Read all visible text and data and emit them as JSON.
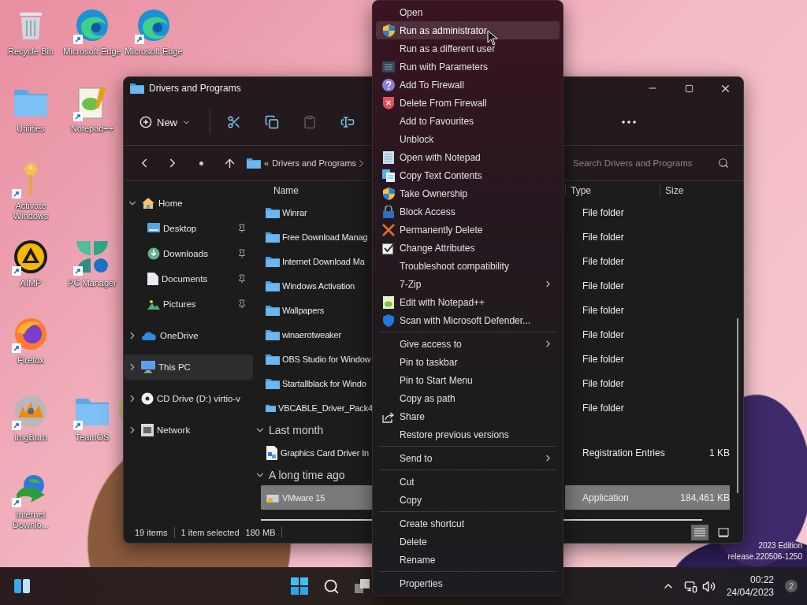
{
  "desktop": {
    "columns": [
      [
        {
          "label": "Recycle Bin",
          "shortcut": false
        },
        {
          "label": "Utilities",
          "shortcut": false
        },
        {
          "label": "Activate Windows",
          "shortcut": true
        },
        {
          "label": "AIMP",
          "shortcut": true
        },
        {
          "label": "Firefox",
          "shortcut": true
        },
        {
          "label": "ImgBurn",
          "shortcut": true
        },
        {
          "label": "Internet Downlo...",
          "shortcut": true
        }
      ],
      [
        {
          "label": "Microsoft Edge",
          "shortcut": true
        },
        {
          "label": "Notepad++",
          "shortcut": true
        },
        {
          "label": "PC Manager",
          "shortcut": true
        },
        {
          "label": "TeamOS",
          "shortcut": true
        }
      ],
      [
        {
          "label": "Microsoft Edge",
          "shortcut": true
        }
      ]
    ]
  },
  "explorer": {
    "title": "Drivers and Programs",
    "toolbar": {
      "new_label": "New",
      "actions": [
        {
          "kind": "cut",
          "disabled": false
        },
        {
          "kind": "copy",
          "disabled": false
        },
        {
          "kind": "paste",
          "disabled": true
        },
        {
          "kind": "rename",
          "disabled": false
        }
      ]
    },
    "address": {
      "crumbs": [
        "«",
        "Drivers and Programs"
      ]
    },
    "search": {
      "placeholder": "Search Drivers and Programs"
    },
    "nav": [
      {
        "label": "Home",
        "expanded": true,
        "selected": false,
        "children": [
          {
            "label": "Desktop",
            "pinned": true,
            "selected": false
          },
          {
            "label": "Downloads",
            "pinned": true,
            "selected": false
          },
          {
            "label": "Documents",
            "pinned": true,
            "selected": false
          },
          {
            "label": "Pictures",
            "pinned": true,
            "selected": false
          }
        ]
      },
      {
        "label": "OneDrive",
        "expanded": false,
        "selected": false
      },
      {
        "label": "This PC",
        "expanded": false,
        "selected": true
      },
      {
        "label": "CD Drive (D:) virtio-v",
        "expanded": false,
        "selected": false
      },
      {
        "label": "Network",
        "expanded": false,
        "selected": false
      }
    ],
    "columns": [
      "Name",
      "Type",
      "Size"
    ],
    "groups": [
      {
        "rows": [
          {
            "name": "Winrar",
            "type": "File folder",
            "kind": "folder",
            "selected": false
          },
          {
            "name": "Free Download Manag",
            "type": "File folder",
            "kind": "folder",
            "selected": false
          },
          {
            "name": "Internet Download Ma",
            "type": "File folder",
            "kind": "folder",
            "selected": false
          },
          {
            "name": "Windows Activation",
            "type": "File folder",
            "kind": "folder",
            "selected": false
          },
          {
            "name": "Wallpapers",
            "type": "File folder",
            "kind": "folder",
            "selected": false
          },
          {
            "name": "winaerotweaker",
            "type": "File folder",
            "kind": "folder",
            "selected": false
          },
          {
            "name": "OBS Studio for Window",
            "type": "File folder",
            "kind": "folder",
            "selected": false
          },
          {
            "name": "Startallblack for Windo",
            "type": "File folder",
            "kind": "folder",
            "selected": false
          },
          {
            "name": "VBCABLE_Driver_Pack4",
            "type": "File folder",
            "kind": "folder",
            "selected": false
          }
        ]
      },
      {
        "title": "Last month",
        "expanded": true,
        "rows": [
          {
            "name": "Graphics Card Driver In",
            "type": "Registration Entries",
            "size": "1 KB",
            "kind": "registry",
            "selected": false
          }
        ]
      },
      {
        "title": "A long time ago",
        "expanded": true,
        "rows": [
          {
            "name": "VMware 15",
            "type": "Application",
            "size": "184,461 KB",
            "kind": "application",
            "selected": true
          }
        ]
      }
    ],
    "status": {
      "count": "19 items",
      "selection": "1 item selected",
      "size": "180 MB"
    },
    "views": [
      {
        "kind": "details",
        "selected": true
      },
      {
        "kind": "tiles",
        "selected": false
      }
    ]
  },
  "context_menu": {
    "sections": [
      [
        {
          "label": "Open",
          "highlighted": false,
          "submenu": false
        },
        {
          "label": "Run as administrator",
          "highlighted": true,
          "submenu": false
        },
        {
          "label": "Run as a different user",
          "highlighted": false,
          "submenu": false
        },
        {
          "label": "Run with Parameters",
          "highlighted": false,
          "submenu": false
        },
        {
          "label": "Add To Firewall",
          "highlighted": false,
          "submenu": false
        },
        {
          "label": "Delete From Firewall",
          "highlighted": false,
          "submenu": false
        },
        {
          "label": "Add to Favourites",
          "highlighted": false,
          "submenu": false
        },
        {
          "label": "Unblock",
          "highlighted": false,
          "submenu": false
        },
        {
          "label": "Open with Notepad",
          "highlighted": false,
          "submenu": false
        },
        {
          "label": "Copy Text Contents",
          "highlighted": false,
          "submenu": false
        },
        {
          "label": "Take Ownership",
          "highlighted": false,
          "submenu": false
        },
        {
          "label": "Block Access",
          "highlighted": false,
          "submenu": false
        },
        {
          "label": "Permanently Delete",
          "highlighted": false,
          "submenu": false
        },
        {
          "label": "Change Attributes",
          "highlighted": false,
          "submenu": false
        },
        {
          "label": "Troubleshoot compatibility",
          "highlighted": false,
          "submenu": false
        },
        {
          "label": "7-Zip",
          "highlighted": false,
          "submenu": true
        },
        {
          "label": "Edit with Notepad++",
          "highlighted": false,
          "submenu": false
        },
        {
          "label": "Scan with Microsoft Defender...",
          "highlighted": false,
          "submenu": false
        }
      ],
      [
        {
          "label": "Give access to",
          "highlighted": false,
          "submenu": true
        },
        {
          "label": "Pin to taskbar",
          "highlighted": false,
          "submenu": false
        },
        {
          "label": "Pin to Start Menu",
          "highlighted": false,
          "submenu": false
        },
        {
          "label": "Copy as path",
          "highlighted": false,
          "submenu": false
        },
        {
          "label": "Share",
          "highlighted": false,
          "submenu": false
        },
        {
          "label": "Restore previous versions",
          "highlighted": false,
          "submenu": false
        }
      ],
      [
        {
          "label": "Send to",
          "highlighted": false,
          "submenu": true
        }
      ],
      [
        {
          "label": "Cut",
          "highlighted": false,
          "submenu": false
        },
        {
          "label": "Copy",
          "highlighted": false,
          "submenu": false
        }
      ],
      [
        {
          "label": "Create shortcut",
          "highlighted": false,
          "submenu": false
        },
        {
          "label": "Delete",
          "highlighted": false,
          "submenu": false
        },
        {
          "label": "Rename",
          "highlighted": false,
          "submenu": false
        }
      ],
      [
        {
          "label": "Properties",
          "highlighted": false,
          "submenu": false
        }
      ]
    ]
  },
  "system_text": [
    "2023 Edition",
    "release.220506-1250"
  ],
  "taskbar": {
    "time": "00:22",
    "date": "24/04/2023",
    "notification_count": "2"
  }
}
